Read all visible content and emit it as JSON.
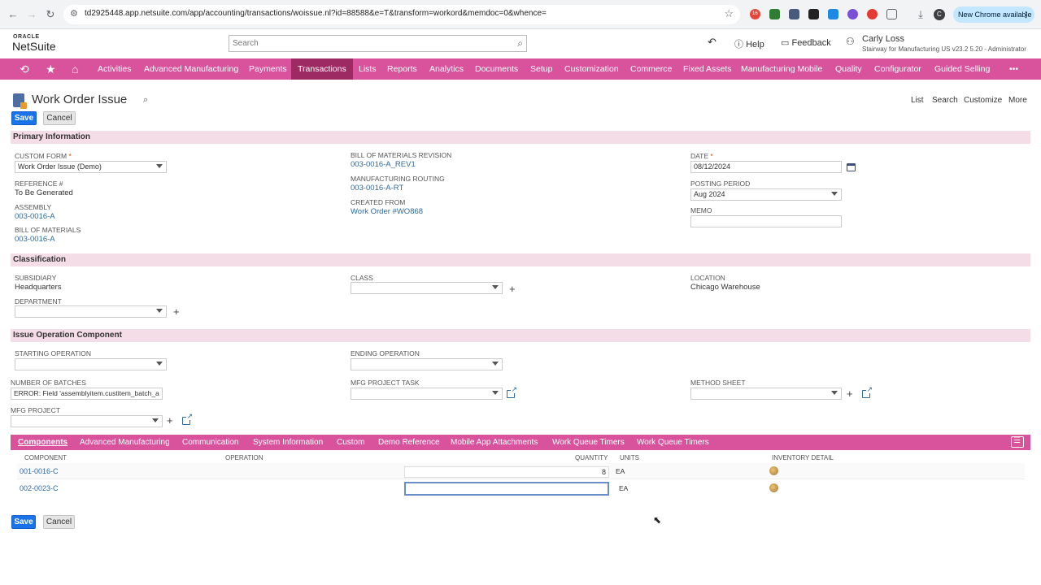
{
  "browser": {
    "url": "td2925448.app.netsuite.com/app/accounting/transactions/woissue.nl?id=88588&e=T&transform=workord&memdoc=0&whence=",
    "new_chrome": "New Chrome available",
    "profile_initial": "C",
    "ext_badge": "16"
  },
  "header": {
    "oracle": "ORACLE",
    "netsuite": "NetSuite",
    "search_placeholder": "Search",
    "help": "Help",
    "feedback": "Feedback",
    "user_name": "Carly Loss",
    "user_role": "Stairway for Manufacturing US v23.2 5.20 - Administrator"
  },
  "nav": {
    "items": [
      "Activities",
      "Advanced Manufacturing",
      "Payments",
      "Transactions",
      "Lists",
      "Reports",
      "Analytics",
      "Documents",
      "Setup",
      "Customization",
      "Commerce",
      "Fixed Assets",
      "Manufacturing Mobile",
      "Quality",
      "Configurator",
      "Guided Selling"
    ],
    "more": "•••"
  },
  "page": {
    "title": "Work Order Issue",
    "links": [
      "List",
      "Search",
      "Customize",
      "More"
    ],
    "save": "Save",
    "cancel": "Cancel"
  },
  "primary": {
    "section": "Primary Information",
    "custom_form_label": "CUSTOM FORM",
    "custom_form_value": "Work Order Issue (Demo)",
    "reference_label": "REFERENCE #",
    "reference_value": "To Be Generated",
    "assembly_label": "ASSEMBLY",
    "assembly_value": "003-0016-A",
    "bom_label": "BILL OF MATERIALS",
    "bom_value": "003-0016-A",
    "bom_rev_label": "BILL OF MATERIALS REVISION",
    "bom_rev_value": "003-0016-A_REV1",
    "routing_label": "MANUFACTURING ROUTING",
    "routing_value": "003-0016-A-RT",
    "created_from_label": "CREATED FROM",
    "created_from_value": "Work Order #WO868",
    "date_label": "DATE",
    "date_value": "08/12/2024",
    "posting_label": "POSTING PERIOD",
    "posting_value": "Aug 2024",
    "memo_label": "MEMO",
    "memo_value": ""
  },
  "classification": {
    "section": "Classification",
    "subsidiary_label": "SUBSIDIARY",
    "subsidiary_value": "Headquarters",
    "department_label": "DEPARTMENT",
    "class_label": "CLASS",
    "location_label": "LOCATION",
    "location_value": "Chicago Warehouse"
  },
  "operation": {
    "section": "Issue Operation Component",
    "starting_label": "STARTING OPERATION",
    "ending_label": "ENDING OPERATION",
    "batches_label": "NUMBER OF BATCHES",
    "batches_value": "ERROR: Field 'assemblyitem.custitem_batch_a",
    "mfg_task_label": "MFG PROJECT TASK",
    "method_sheet_label": "METHOD SHEET",
    "mfg_project_label": "MFG PROJECT"
  },
  "subtabs": [
    "Components",
    "Advanced Manufacturing",
    "Communication",
    "System Information",
    "Custom",
    "Demo Reference",
    "Mobile App Attachments",
    "Work Queue Timers",
    "Work Queue Timers"
  ],
  "components": {
    "headers": [
      "COMPONENT",
      "OPERATION",
      "QUANTITY",
      "UNITS",
      "INVENTORY DETAIL"
    ],
    "rows": [
      {
        "component": "001-0016-C",
        "quantity": "8",
        "units": "EA"
      },
      {
        "component": "002-0023-C",
        "quantity": "",
        "units": "EA"
      }
    ]
  },
  "colors": {
    "nav": "#d9529c",
    "nav_active": "#9e2a63",
    "section": "#f5dde8",
    "primary_button": "#1a73e8",
    "link": "#2d6a9f"
  }
}
